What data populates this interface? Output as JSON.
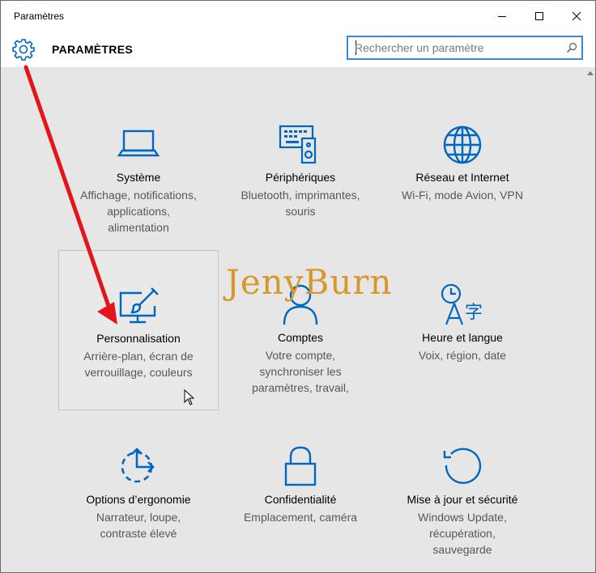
{
  "window": {
    "title": "Paramètres"
  },
  "controls": {
    "minimize_icon": "minimize-icon",
    "maximize_icon": "maximize-icon",
    "close_icon": "close-icon"
  },
  "header": {
    "title": "PARAMÈTRES",
    "icon": "gear-icon"
  },
  "search": {
    "placeholder": "Rechercher un paramètre",
    "value": "",
    "icon": "search-icon"
  },
  "accent_color": "#0067c0",
  "tiles": [
    {
      "label": "Système",
      "desc": [
        "Affichage, notifications,",
        "applications,",
        "alimentation"
      ],
      "icon": "laptop-icon"
    },
    {
      "label": "Périphériques",
      "desc": [
        "Bluetooth, imprimantes,",
        "souris"
      ],
      "icon": "devices-icon"
    },
    {
      "label": "Réseau et Internet",
      "desc": [
        "Wi-Fi, mode Avion, VPN"
      ],
      "icon": "globe-icon"
    },
    {
      "label": "Personnalisation",
      "desc": [
        "Arrière-plan, écran de",
        "verrouillage, couleurs"
      ],
      "icon": "paint-monitor-icon"
    },
    {
      "label": "Comptes",
      "desc": [
        "Votre compte,",
        "synchroniser les",
        "paramètres, travail,"
      ],
      "icon": "user-icon"
    },
    {
      "label": "Heure et langue",
      "desc": [
        "Voix, région, date"
      ],
      "icon": "time-language-icon"
    },
    {
      "label": "Options d’ergonomie",
      "desc": [
        "Narrateur, loupe,",
        "contraste élevé"
      ],
      "icon": "ease-of-access-icon"
    },
    {
      "label": "Confidentialité",
      "desc": [
        "Emplacement, caméra"
      ],
      "icon": "lock-icon"
    },
    {
      "label": "Mise à jour et sécurité",
      "desc": [
        "Windows Update,",
        "récupération,",
        "sauvegarde"
      ],
      "icon": "update-icon"
    }
  ],
  "watermark": {
    "text": "JenyBurn"
  },
  "annotation": {
    "arrow_color": "#e3151a"
  }
}
